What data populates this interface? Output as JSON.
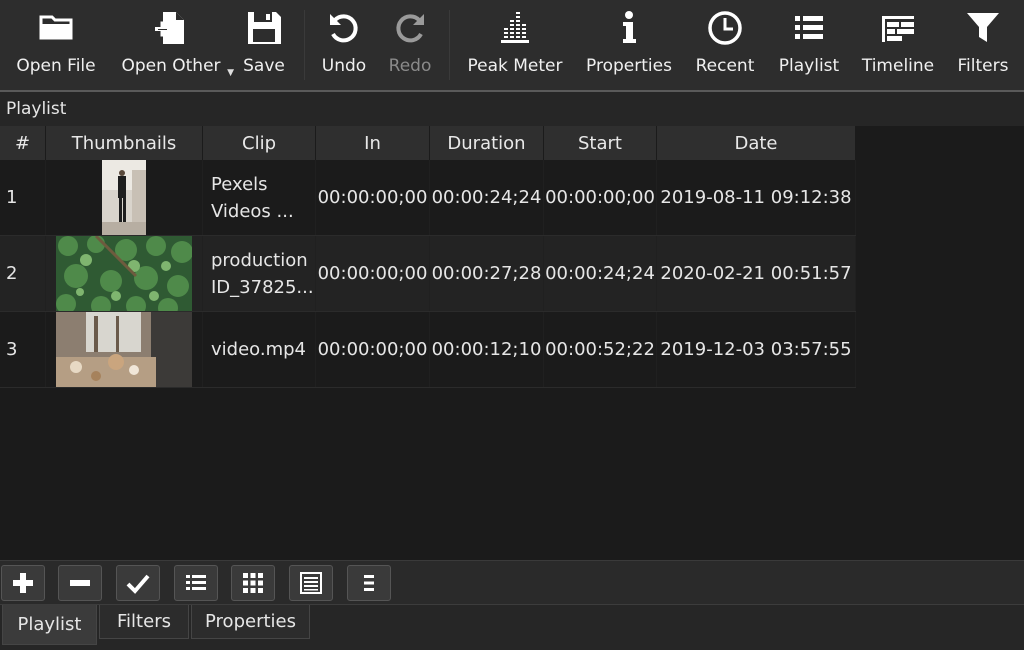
{
  "toolbar": {
    "open_file": "Open File",
    "open_other": "Open Other",
    "save": "Save",
    "undo": "Undo",
    "redo": "Redo",
    "peak_meter": "Peak Meter",
    "properties": "Properties",
    "recent": "Recent",
    "playlist": "Playlist",
    "timeline": "Timeline",
    "filters": "Filters"
  },
  "dock": {
    "title": "Playlist"
  },
  "table": {
    "headers": [
      "#",
      "Thumbnails",
      "Clip",
      "In",
      "Duration",
      "Start",
      "Date"
    ],
    "rows": [
      {
        "num": "1",
        "clip": "Pexels\nVideos ...",
        "in": "00:00:00;00",
        "duration": "00:00:24;24",
        "start": "00:00:00;00",
        "date": "2019-08-11 09:12:38"
      },
      {
        "num": "2",
        "clip": "production\nID_37825...",
        "in": "00:00:00;00",
        "duration": "00:00:27;28",
        "start": "00:00:24;24",
        "date": "2020-02-21 00:51:57"
      },
      {
        "num": "3",
        "clip": "video.mp4",
        "in": "00:00:00;00",
        "duration": "00:00:12;10",
        "start": "00:00:52;22",
        "date": "2019-12-03 03:57:55"
      }
    ]
  },
  "tabs": {
    "playlist": "Playlist",
    "filters": "Filters",
    "properties": "Properties",
    "active": "Playlist"
  },
  "icons": {
    "open_file": "folder-icon",
    "open_other": "file-plus-icon",
    "save": "floppy-icon",
    "undo": "undo-icon",
    "redo": "redo-icon",
    "peak_meter": "meter-icon",
    "properties": "info-icon",
    "recent": "clock-icon",
    "playlist": "list-icon",
    "timeline": "timeline-icon",
    "filters": "funnel-icon"
  },
  "colors": {
    "background": "#1b1b1b",
    "toolbar": "#2d2d2d",
    "text": "#e6e6e6",
    "disabled": "#8a8a8a"
  }
}
